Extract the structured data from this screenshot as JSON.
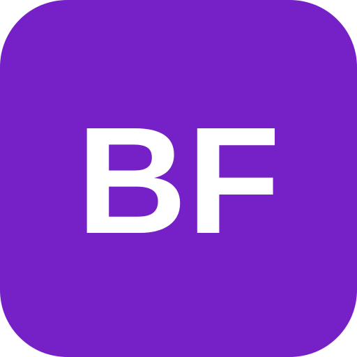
{
  "app_icon": {
    "initials": "BF",
    "background_color": "#7620C8",
    "text_color": "#FFFFFF"
  }
}
